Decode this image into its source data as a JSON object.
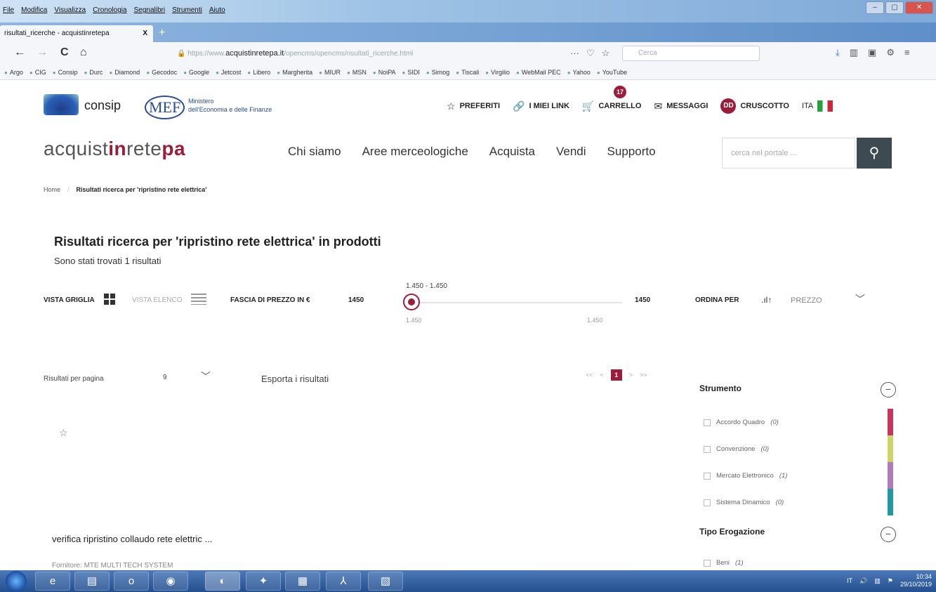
{
  "window": {
    "menus": [
      "File",
      "Modifica",
      "Visualizza",
      "Cronologia",
      "Segnalibri",
      "Strumenti",
      "Aiuto"
    ],
    "tab_title": "risultati_ricerche - acquistinretepa",
    "tab_close": "X",
    "new_tab": "+"
  },
  "navbar": {
    "url_prefix": "https://www.",
    "url_host": "acquistinretepa.it",
    "url_path": "/opencms/opencms/risultati_ricerche.html",
    "search_placeholder": "Cerca",
    "back": "←",
    "forward": "→",
    "reload": "C",
    "home": "⌂"
  },
  "bookmarks": [
    "Argo",
    "CIG",
    "Consip",
    "Durc",
    "Diamond",
    "Gecodoc",
    "Google",
    "Jetcost",
    "Libero",
    "Margherita",
    "MIUR",
    "MSN",
    "NoiPA",
    "SIDI",
    "Simog",
    "Tiscali",
    "Virgilio",
    "WebMail PEC",
    "Yahoo",
    "YouTube"
  ],
  "header": {
    "consip": "consip",
    "mef": "MEF",
    "mef_text_1": "Ministero",
    "mef_text_2": "dell'Economia e delle Finanze",
    "preferiti": "PREFERITI",
    "miei_link": "I MIEI LINK",
    "cart_count": "17",
    "carrello": "CARRELLO",
    "messaggi": "MESSAGGI",
    "avatar": "DD",
    "cruscotto": "CRUSCOTTO",
    "lang": "ITA"
  },
  "brand": {
    "part1": "acquist",
    "part2": "in",
    "part3": "rete",
    "part4": "pa"
  },
  "mainnav": [
    "Chi siamo",
    "Aree merceologiche",
    "Acquista",
    "Vendi",
    "Supporto"
  ],
  "portal_search_placeholder": "cerca nel portale ...",
  "breadcrumb": {
    "home": "Home",
    "sep": "/",
    "current": "Risultati ricerca per 'ripristino rete elettrica'"
  },
  "results": {
    "title": "Risultati ricerca per 'ripristino rete elettrica' in prodotti",
    "count": "Sono stati trovati 1 risultati"
  },
  "filters": {
    "vista_griglia": "VISTA GRIGLIA",
    "vista_elenco": "VISTA ELENCO",
    "fascia": "FASCIA DI PREZZO IN €",
    "price_min": "1450",
    "range_label": "1.450 - 1.450",
    "range_low": "1.450",
    "range_high": "1.450",
    "price_max": "1450",
    "ordina_per": "ORDINA PER",
    "prezzo": "PREZZO"
  },
  "controls": {
    "per_page_label": "Risultati per pagina",
    "per_page_value": "9",
    "export": "Esporta i risultati",
    "pag_first": "<<",
    "pag_prev": "<",
    "pag_current": "1",
    "pag_next": ">",
    "pag_last": ">>"
  },
  "product": {
    "title": "verifica ripristino collaudo rete elettric ...",
    "supplier": "Fornitore: MTE MULTI TECH SYSTEM"
  },
  "sidebar": {
    "strumento": "Strumento",
    "strumento_items": [
      {
        "label": "Accordo Quadro",
        "count": "(0)",
        "color": "#c8365e"
      },
      {
        "label": "Convenzione",
        "count": "(0)",
        "color": "#cfd46a"
      },
      {
        "label": "Mercato Elettronico",
        "count": "(1)",
        "color": "#b07cb8"
      },
      {
        "label": "Sistema Dinamico",
        "count": "(0)",
        "color": "#1f9aa0"
      }
    ],
    "tipo_erogazione": "Tipo Erogazione",
    "tipo_items": [
      {
        "label": "Beni",
        "count": "(1)"
      }
    ]
  },
  "taskbar": {
    "time": "10:34",
    "date": "29/10/2019",
    "lang": "IT"
  }
}
